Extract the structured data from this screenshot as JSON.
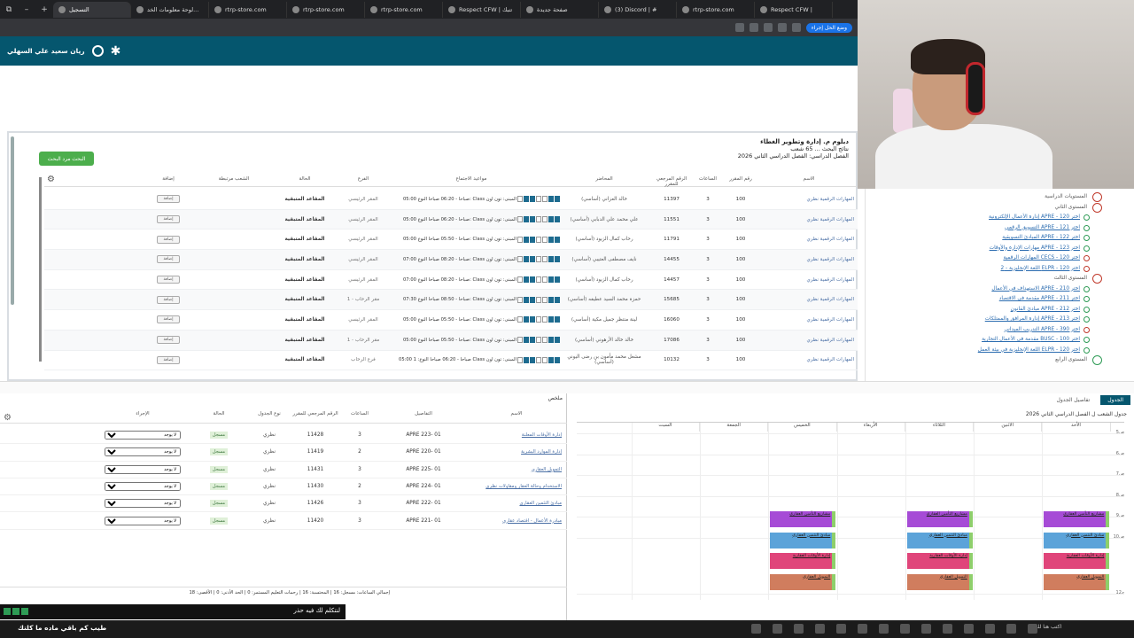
{
  "browser": {
    "tabs": [
      "التسجيل",
      "لوحة معلومات الخد...",
      "rtrp-store.com",
      "rtrp-store.com",
      "rtrp-store.com",
      "Respect CFW | تنبك",
      "صفحة جديدة",
      "(3) Discord | #",
      "rtrp-store.com",
      "Respect CFW |"
    ],
    "addr_pill": "وضع الحل إجراء"
  },
  "header": {
    "user_name": "ريان سعيد علي السهلي"
  },
  "program": {
    "title": "دبلوم م. إدارة وتطوير الغطاء",
    "results": "نتائج البحث ... 65 شعب",
    "term": "الفصل الدراسي: الفصل الدراسي الثاني 2026",
    "adv_button": "البحث مرد البحث"
  },
  "sections_table": {
    "headers": [
      "الاسم",
      "رقم المقرر",
      "الساعات",
      "الرقم المرجعي للمقرر",
      "المحاضر",
      "مواعيد الاجتماع",
      "الفرع",
      "الحالة",
      "الشعب مرتبطة",
      "إضافة"
    ],
    "rows": [
      {
        "name": "المهارات الرقمية نظري",
        "sec": "100",
        "hrs": "3",
        "crn": "11397",
        "ins": "خالد العزاني (أساسي)",
        "time": "05:00 صباحا - 06:20 صباحا النوع: Class المبنى: تون اون",
        "branch": "المقر الرئيسي",
        "status": "المقاعد المتبقية",
        "add": "إضافة"
      },
      {
        "name": "المهارات الرقمية نظري",
        "sec": "100",
        "hrs": "3",
        "crn": "11551",
        "ins": "علي محمد علي الدبابي (أساسي)",
        "time": "05:00 صباحا - 06:20 صباحا النوع: Class المبنى: تون اون",
        "branch": "المقر الرئيسي",
        "status": "المقاعد المتبقية",
        "add": "إضافة"
      },
      {
        "name": "المهارات الرقمية نظري",
        "sec": "100",
        "hrs": "3",
        "crn": "11791",
        "ins": "رحاب كمال الزيود (أساسي)",
        "time": "05:00 صباحا - 05:50 صباحا النوع: Class المبنى: تون اون",
        "branch": "المقر الرئيسي",
        "status": "المقاعد المتبقية",
        "add": "إضافة"
      },
      {
        "name": "المهارات الرقمية نظري",
        "sec": "100",
        "hrs": "3",
        "crn": "14455",
        "ins": "نايف مصطفى العتيبي (أساسي)",
        "time": "07:00 صباحا - 08:20 صباحا النوع: Class المبنى: تون اون",
        "branch": "المقر الرئيسي",
        "status": "المقاعد المتبقية",
        "add": "إضافة"
      },
      {
        "name": "المهارات الرقمية نظري",
        "sec": "100",
        "hrs": "3",
        "crn": "14457",
        "ins": "رحاب كمال الزيود (أساسي)",
        "time": "07:00 صباحا - 08:20 صباحا النوع: Class المبنى: تون اون",
        "branch": "المقر الرئيسي",
        "status": "المقاعد المتبقية",
        "add": "إضافة"
      },
      {
        "name": "المهارات الرقمية نظري",
        "sec": "100",
        "hrs": "3",
        "crn": "15685",
        "ins": "حمزة محمد السيد عطيفه (أساسي)",
        "time": "07:30 صباحا - 08:50 صباحا النوع: Class المبنى: تون اون",
        "branch": "مقر الرحاب - 1",
        "status": "المقاعد المتبقية",
        "add": "إضافة"
      },
      {
        "name": "المهارات الرقمية نظري",
        "sec": "100",
        "hrs": "3",
        "crn": "16060",
        "ins": "لينة منتظر جميل مكية (أساسي)",
        "time": "05:00 صباحا - 05:50 صباحا النوع: Class المبنى: تون اون",
        "branch": "المقر الرئيسي",
        "status": "المقاعد المتبقية",
        "add": "إضافة"
      },
      {
        "name": "المهارات الرقمية نظري",
        "sec": "100",
        "hrs": "3",
        "crn": "17086",
        "ins": "خالد خالد الأرهوني (أساسي)",
        "time": "05:00 صباحا - 05:50 صباحا النوع: Class المبنى: تون اون",
        "branch": "مقر الرحاب - 1",
        "status": "المقاعد المتبقية",
        "add": "إضافة"
      },
      {
        "name": "المهارات الرقمية نظري",
        "sec": "100",
        "hrs": "3",
        "crn": "10132",
        "ins": "مشعل محمد مأمون بن رضى اليوني (أساسي)",
        "time": "05:00 صباحا - 06:20 صباحا النوع: 1 Class المبنى: تون اون",
        "branch": "فرع الرحاب",
        "status": "المقاعد المتبقية",
        "add": "إضافة"
      }
    ]
  },
  "progress": {
    "level1": "المستويات الدراسية",
    "level2": "المستوى الثاني",
    "l2items": [
      "اختر APRE - 120 إدارة الأعمال الإلكترونية",
      "اختر APRE - 121 التسويق الرقمي",
      "اختر APRE - 122 المبادئ التسويقية",
      "اختر APRE - 123 مهارات الإدارة والأوقات",
      "اختر CECS - 120 المهارات الرقمية",
      "اختر ELPR - 120 اللغة الإنجليزية - 2"
    ],
    "level3": "المستوى الثالث",
    "l3items": [
      "اختر APRE - 210 الاستهداف في الأعمال",
      "اختر APRE - 211 مقدمة في الاقتصاد",
      "اختر APRE - 212 مبادئ القانون",
      "اختر APRE - 213 إدارة المرافق والممتلكات",
      "اختر APRE - 390 التدريب الميداني",
      "اختر BUSC - 100 مقدمة في الأعمال التجارية",
      "اختر ELPR - 120 اللغة الإنجليزية في بيئة العمل"
    ],
    "level4": "المستوى الرابع"
  },
  "summary": {
    "tab": "ملخص",
    "headers": [
      "الاسم",
      "التفاصيل",
      "الساعات",
      "الرقم المرجعي للمقرر",
      "نوع الجدول",
      "الحالة",
      "الإجراء"
    ],
    "rows": [
      {
        "name": "إدارة الأوقات المعلنة",
        "sec": "APRE 223- 01",
        "hrs": "3",
        "crn": "11428",
        "type": "نظري",
        "st": "مسجل",
        "act": "لا يوجد"
      },
      {
        "name": "إدارة الموارد البشرية",
        "sec": "APRE 220- 01",
        "hrs": "2",
        "crn": "11419",
        "type": "نظري",
        "st": "مسجل",
        "act": "لا يوجد"
      },
      {
        "name": "التمويل العقاري",
        "sec": "APRE 225- 01",
        "hrs": "3",
        "crn": "11431",
        "type": "نظري",
        "st": "مسجل",
        "act": "لا يوجد"
      },
      {
        "name": "الاستخدام وحالة العقار ومقاولات نظري",
        "sec": "APRE 224- 01",
        "hrs": "2",
        "crn": "11430",
        "type": "نظري",
        "st": "مسجل",
        "act": "لا يوجد"
      },
      {
        "name": "مبادئ التثمين العقاري",
        "sec": "APRE 222- 01",
        "hrs": "3",
        "crn": "11426",
        "type": "نظري",
        "st": "مسجل",
        "act": "لا يوجد"
      },
      {
        "name": "مبادرة الأعمال - اقتصاد عقاري",
        "sec": "APRE 221- 01",
        "hrs": "3",
        "crn": "11420",
        "type": "نظري",
        "st": "مسجل",
        "act": "لا يوجد"
      }
    ],
    "footer": "إجمالي الساعات: مسجل: 16 | المحتسبة: 16 | رحمات التعليم المستمر: 0 | الحد الأدنى: 0 | الأقصى: 18"
  },
  "schedule": {
    "tab_active": "الجدول",
    "tab_other": "تفاصيل الجدول",
    "title": "جدول الشعب ل الفصل الدراسي الثاني 2026",
    "days": [
      "الأحد",
      "الاثنين",
      "الثلاثاء",
      "الأربعاء",
      "الخميس",
      "الجمعة",
      "السبت"
    ],
    "times": [
      "5ص",
      "6ص",
      "7ص",
      "8ص",
      "9ص",
      "10ص",
      "12م"
    ],
    "blocks": [
      {
        "label": "مشاريع التأمين العقاري",
        "color": "#a64bd6"
      },
      {
        "label": "مبادئ التثمين العقاري",
        "color": "#5ba3d9"
      },
      {
        "label": "إدارة الأوقات العقارية",
        "color": "#e0457a"
      },
      {
        "label": "التمويل العقاري",
        "color": "#d07d5e"
      }
    ]
  },
  "chat": {
    "line1": "لنتكلم لك فيه حذر",
    "line2": "طيب كم باقي ماده ما كلتك"
  },
  "taskbar": {
    "search": "اكتب هنا للبحث"
  }
}
